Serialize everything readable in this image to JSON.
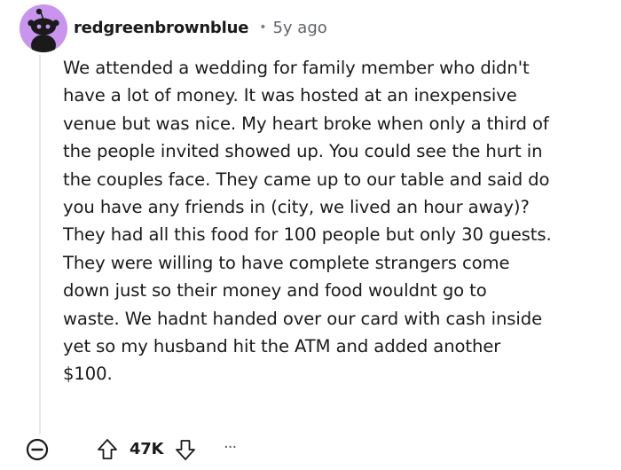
{
  "comment": {
    "username": "redgreenbrownblue",
    "separator": "•",
    "age": "5y ago",
    "body": "We attended a wedding for family member who didn't\nhave a lot of money. It was hosted at an inexpensive\nvenue but was nice. My heart broke when only a third of\nthe people invited showed up. You could see the hurt in\nthe couples face. They came up to our table and said do\nyou have any friends in (city, we lived an hour away)?\nThey had all this food for 100 people but only 30 guests.\nThey were willing to have complete strangers come\ndown just so their money and food wouldnt go to\nwaste. We hadnt handed over our card with cash inside\nyet so my husband hit the ATM and added another\n$100.",
    "score": "47K",
    "more_label": "···"
  },
  "icons": {
    "avatar": "snoo-avatar",
    "collapse": "collapse-minus-icon",
    "upvote": "upvote-arrow-icon",
    "downvote": "downvote-arrow-icon",
    "more": "ellipsis-icon"
  },
  "colors": {
    "avatar_bg": "#c894ee",
    "text": "#1a1a1b",
    "meta": "#5f6368",
    "thread_line": "#e5e7ea"
  }
}
